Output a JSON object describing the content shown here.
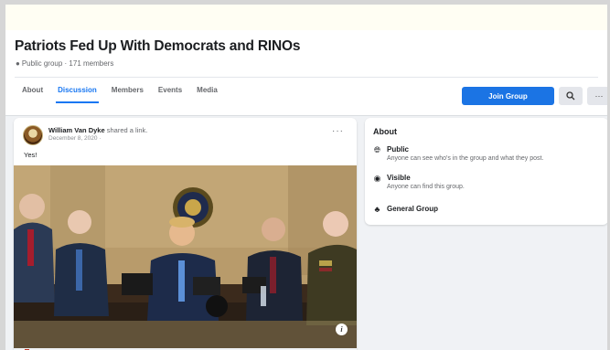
{
  "group": {
    "title": "Patriots Fed Up With Democrats and RINOs",
    "meta": "Public group · 171 members"
  },
  "tabs": [
    {
      "label": "About"
    },
    {
      "label": "Discussion"
    },
    {
      "label": "Members"
    },
    {
      "label": "Events"
    },
    {
      "label": "Media"
    }
  ],
  "actions": {
    "join_label": "Join Group",
    "search_icon": "search-icon",
    "more_icon": "more-icon"
  },
  "post": {
    "author": "William Van Dyke",
    "action": "shared a link.",
    "date": "December 8, 2020 ·",
    "text": "Yes!",
    "menu": "···"
  },
  "about": {
    "title": "About",
    "items": [
      {
        "icon": "globe-icon",
        "title": "Public",
        "desc": "Anyone can see who's in the group and what they post."
      },
      {
        "icon": "eye-icon",
        "title": "Visible",
        "desc": "Anyone can find this group."
      },
      {
        "icon": "group-icon",
        "title": "General Group",
        "desc": ""
      }
    ]
  },
  "colors": {
    "accent": "#1b74e4",
    "page_bg": "#f0f2f5"
  }
}
